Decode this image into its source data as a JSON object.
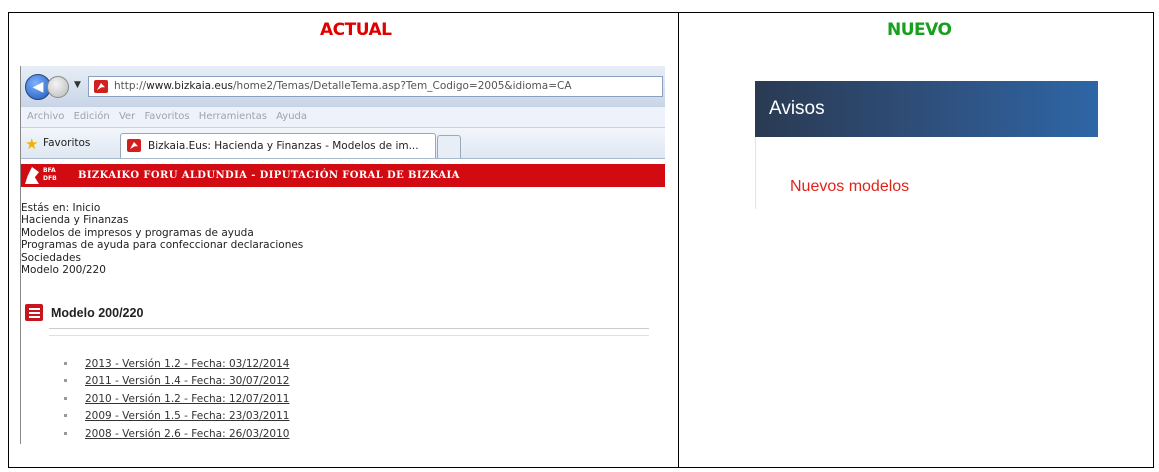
{
  "headers": {
    "actual": "ACTUAL",
    "nuevo": "NUEVO"
  },
  "browser": {
    "url_prefix": "http://",
    "url_domain": "www.bizkaia.eus",
    "url_path": "/home2/Temas/DetalleTema.asp?Tem_Codigo=2005&idioma=CA",
    "menu": [
      "Archivo",
      "Edición",
      "Ver",
      "Favoritos",
      "Herramientas",
      "Ayuda"
    ],
    "favorites_label": "Favoritos",
    "tab_title": "Bizkaia.Eus: Hacienda y Finanzas - Modelos de im..."
  },
  "site": {
    "logo_small_1": "BFA",
    "logo_small_2": "DFB",
    "banner": "BIZKAIKO FORU ALDUNDIA - DIPUTACIÓN FORAL DE BIZKAIA",
    "breadcrumb_label": "Estás en:",
    "breadcrumb": [
      "Inicio",
      "Hacienda y Finanzas",
      "Modelos de impresos y programas de ayuda",
      "Programas de ayuda para confeccionar declaraciones",
      "Sociedades",
      "Modelo 200/220"
    ],
    "section_title": "Modelo 200/220",
    "models": [
      "2013 - Versión 1.2 - Fecha: 03/12/2014",
      "2011 - Versión 1.4 - Fecha: 30/07/2012",
      "2010 - Versión 1.2 - Fecha: 12/07/2011",
      "2009 - Versión 1.5 - Fecha: 23/03/2011",
      "2008 - Versión 2.6 - Fecha: 26/03/2010"
    ]
  },
  "nuevo": {
    "panel_title": "Avisos",
    "link": "Nuevos modelos"
  },
  "colors": {
    "actual_header": "#e00000",
    "nuevo_header": "#17a01e",
    "banner": "#d20a11",
    "avisos_bar": "#2f5383",
    "link": "#e0231b"
  }
}
